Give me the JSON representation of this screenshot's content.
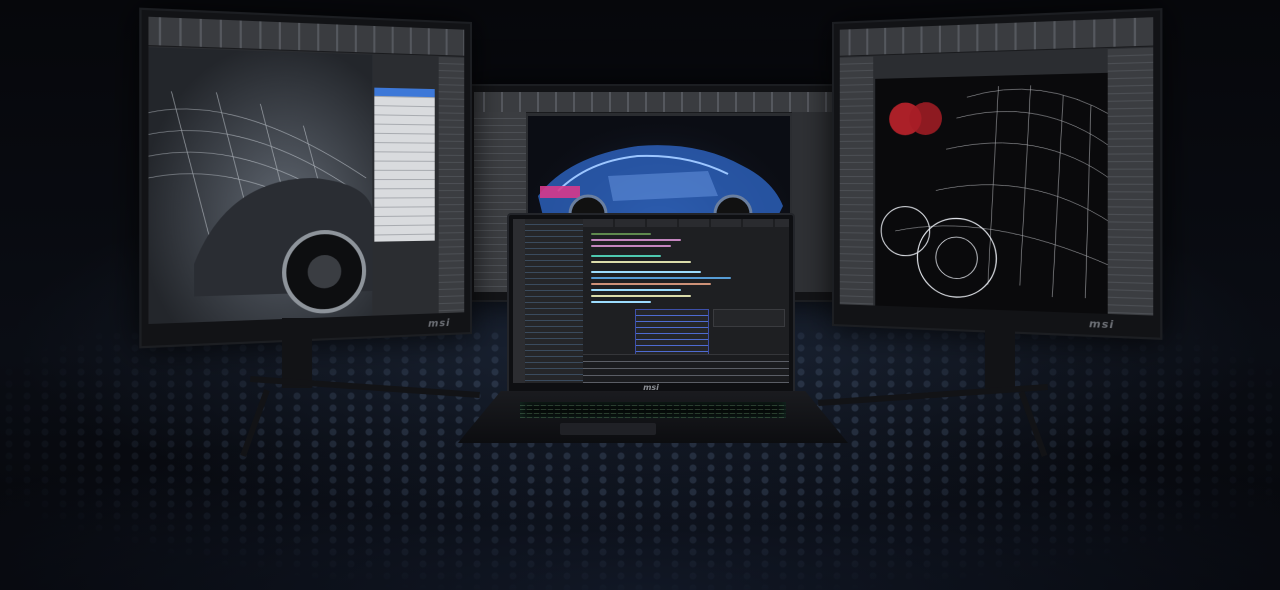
{
  "scene": {
    "description_colors": {
      "accent_blue": "#3d78d8",
      "car_magenta": "#d63a8c",
      "wireframe_red": "#c8242e"
    }
  },
  "monitors": {
    "left": {
      "brand": "msi"
    },
    "right": {
      "brand": "msi"
    }
  },
  "laptop": {
    "brand": "msi"
  }
}
